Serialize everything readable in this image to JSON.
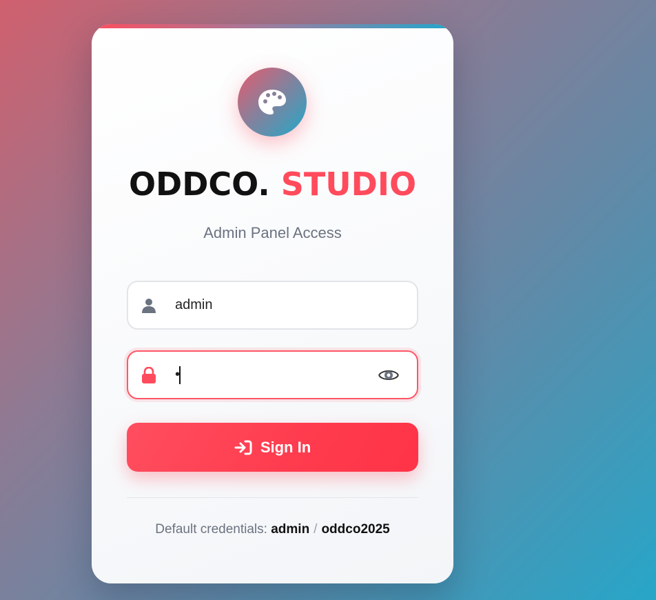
{
  "brand": {
    "name_primary": "ODDCO.",
    "name_accent": "STUDIO",
    "logo_icon": "palette-icon",
    "subtitle": "Admin Panel Access"
  },
  "form": {
    "username": {
      "value": "admin",
      "icon": "user-icon"
    },
    "password": {
      "masked_value": "•",
      "icon": "lock-icon",
      "toggle_icon": "eye-icon"
    },
    "submit_label": "Sign In",
    "submit_icon": "sign-in-icon"
  },
  "footer": {
    "label": "Default credentials:",
    "username": "admin",
    "separator": "/",
    "password": "oddco2025"
  },
  "colors": {
    "accent": "#ff4b5c",
    "teal": "#22a6cc",
    "text_muted": "#6b7280"
  }
}
